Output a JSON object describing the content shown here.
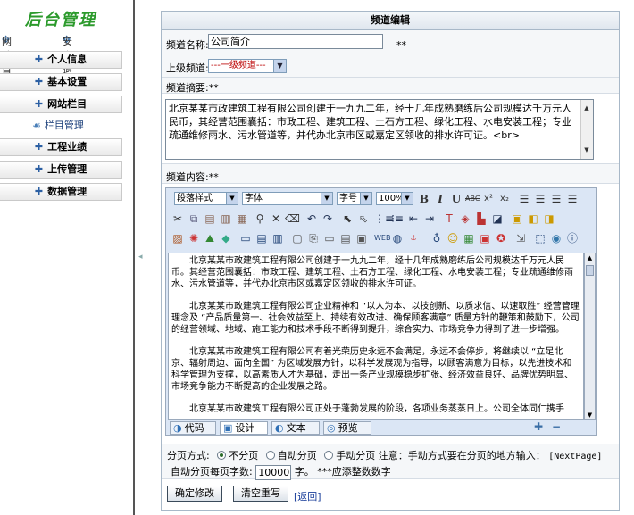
{
  "sidebar": {
    "logo": "后台管理",
    "home_link": "网站首页",
    "logout_link": "安全退出",
    "items": [
      {
        "label": "个人信息"
      },
      {
        "label": "基本设置"
      },
      {
        "label": "网站栏目"
      },
      {
        "label": "工程业绩"
      },
      {
        "label": "上传管理"
      },
      {
        "label": "数据管理"
      }
    ],
    "sub_item": "栏目管理"
  },
  "panel": {
    "title": "频道编辑",
    "name_label": "频道名称:",
    "name_value": "公司简介",
    "required_mark": "**",
    "parent_label": "上级频道:",
    "parent_value": "---一级频道---",
    "summary_label": "频道摘要:**",
    "summary_text": "北京某某市政建筑工程有限公司创建于一九九二年，经十几年成熟磨练后公司规模达千万元人民币，其经营范围囊括：市政工程、建筑工程、土石方工程、绿化工程、水电安装工程；专业疏通维修雨水、污水管道等，并代办北京市区或嘉定区领收的排水许可证。<br>",
    "content_label": "频道内容:**"
  },
  "editor": {
    "paragraph_style": "段落样式",
    "font": "字体",
    "font_size": "字号",
    "zoom": "100%",
    "paragraphs": [
      "北京某某市政建筑工程有限公司创建于一九九二年，经十几年成熟磨练后公司规模达千万元人民币。其经营范围囊括：市政工程、建筑工程、土石方工程、绿化工程、水电安装工程；专业疏通维修雨水、污水管道等，并代办北京市区或嘉定区领收的排水许可证。",
      "北京某某市政建筑工程有限公司企业精神和 “以人为本、以技创新、以质求信、以速取胜” 经营管理理念及 “产品质量第一、社会效益至上、持续有效改进、确保顾客满意” 质量方针的鞭策和鼓励下，公司的经营领域、地域、施工能力和技术手段不断得到提升，综合实力、市场竞争力得到了进一步增强。",
      "北京某某市政建筑工程有限公司有着光荣历史永远不会满足，永远不会停步，将继续以 “立足北京、辐射周边、面向全国” 为区域发展方针，以科学发展观为指导，以顾客满意为目标，以先进技术和科学管理为支撑，以高素质人才为基础，走出一条产业规模稳步扩张、经济效益良好、品牌优势明显、市场竞争能力不断提高的企业发展之路。",
      "北京某某市政建筑工程有限公司正处于蓬勃发展的阶段，各项业务蒸蒸日上。公司全体同仁携手"
    ],
    "modes": [
      "代码",
      "设计",
      "文本",
      "预览"
    ]
  },
  "paging": {
    "label": "分页方式:",
    "options": [
      "不分页",
      "自动分页",
      "手动分页"
    ],
    "selected": "不分页",
    "note": "注意：手动方式要在分页的地方输入：",
    "marker": "[NextPage]",
    "chars_label": "自动分页每页字数:",
    "chars_value": "10000",
    "chars_unit": "字。",
    "chars_note": "***应添整数数字"
  },
  "actions": {
    "confirm": "确定修改",
    "reset": "清空重写",
    "back": "[返回]"
  }
}
